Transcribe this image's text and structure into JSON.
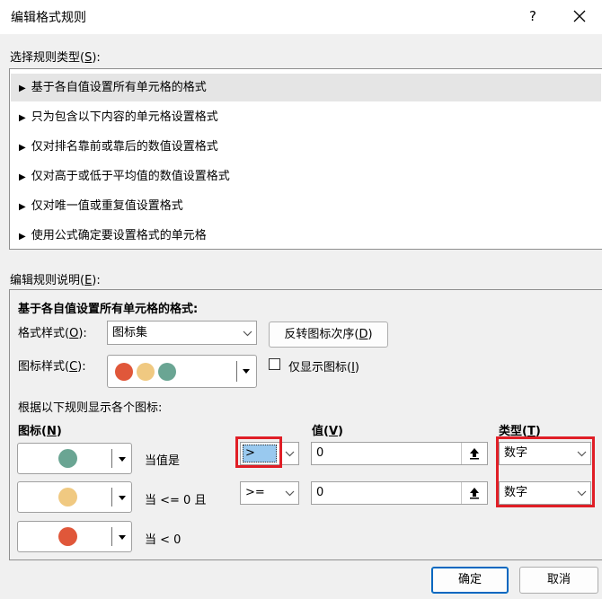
{
  "window": {
    "title": "编辑格式规则",
    "help": "?",
    "close": "✕"
  },
  "rule_type": {
    "label_prefix": "选择规则类型(",
    "label_key": "S",
    "label_suffix": "):",
    "items": [
      {
        "label": "基于各自值设置所有单元格的格式",
        "selected": true
      },
      {
        "label": "只为包含以下内容的单元格设置格式"
      },
      {
        "label": "仅对排名靠前或靠后的数值设置格式"
      },
      {
        "label": "仅对高于或低于平均值的数值设置格式"
      },
      {
        "label": "仅对唯一值或重复值设置格式"
      },
      {
        "label": "使用公式确定要设置格式的单元格"
      }
    ]
  },
  "edit": {
    "label_prefix": "编辑规则说明(",
    "label_key": "E",
    "label_suffix": "):",
    "heading": "基于各自值设置所有单元格的格式:",
    "format_style_prefix": "格式样式(",
    "format_style_key": "O",
    "format_style_suffix": "):",
    "format_style_value": "图标集",
    "reverse_prefix": "反转图标次序(",
    "reverse_key": "D",
    "reverse_suffix": ")",
    "icon_style_prefix": "图标样式(",
    "icon_style_key": "C",
    "icon_style_suffix": "):",
    "show_icon_only_prefix": "仅显示图标(",
    "show_icon_only_key": "I",
    "show_icon_only_suffix": ")",
    "rules_caption": "根据以下规则显示各个图标:",
    "col_icon_prefix": "图标(",
    "col_icon_key": "N",
    "col_icon_suffix": ")",
    "col_value_prefix": "值(",
    "col_value_key": "V",
    "col_value_suffix": ")",
    "col_type_prefix": "类型(",
    "col_type_key": "T",
    "col_type_suffix": ")",
    "rows": [
      {
        "color": "#6aa593",
        "cond": "当值是",
        "op": ">",
        "value": "0",
        "type": "数字"
      },
      {
        "color": "#f0c981",
        "cond": "当 <= 0 且",
        "op": ">=",
        "value": "0",
        "type": "数字"
      },
      {
        "color": "#e0573a",
        "cond": "当 < 0"
      }
    ],
    "icon_set_colors": [
      "#e0573a",
      "#f0c981",
      "#6aa593"
    ]
  },
  "buttons": {
    "ok": "确定",
    "cancel": "取消"
  },
  "highlight_color": "#e01e26"
}
